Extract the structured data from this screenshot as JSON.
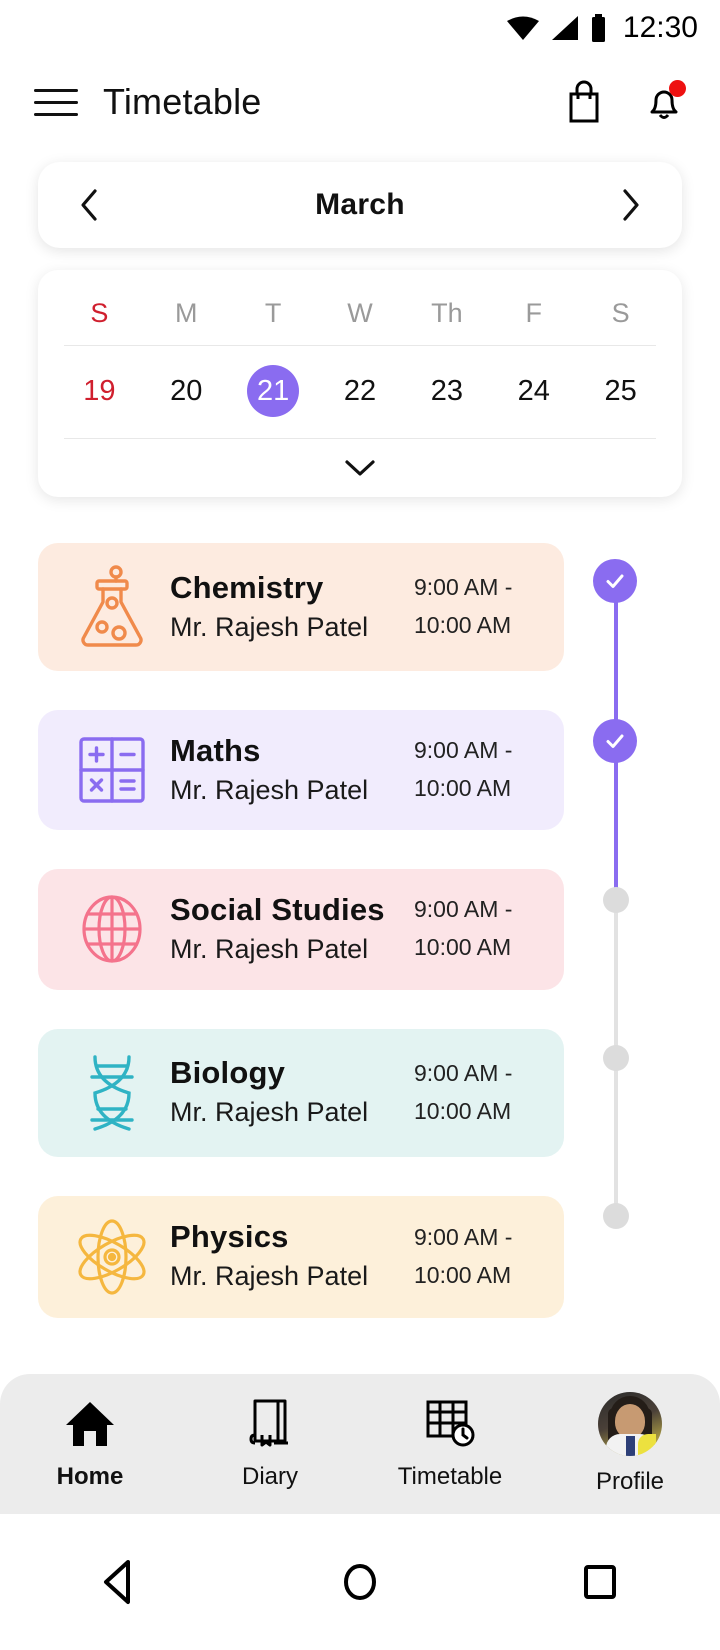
{
  "status_bar": {
    "time": "12:30",
    "wifi_icon": "wifi-icon",
    "signal_icon": "signal-icon",
    "battery_icon": "battery-icon"
  },
  "app_bar": {
    "title": "Timetable",
    "menu_icon": "hamburger-menu-icon",
    "bag_icon": "shopping-bag-icon",
    "bell_icon": "notification-bell-icon",
    "has_notification": true
  },
  "calendar": {
    "month": "March",
    "prev_label": "‹",
    "next_label": "›",
    "day_initials": [
      "S",
      "M",
      "T",
      "W",
      "Th",
      "F",
      "S"
    ],
    "dates": [
      "19",
      "20",
      "21",
      "22",
      "23",
      "24",
      "25"
    ],
    "selected_date": "21",
    "sunday_color": "#d01f2e",
    "selected_color": "#8a6cf0",
    "expand_icon": "chevron-down-icon"
  },
  "timetable": {
    "teacher_default": "Mr. Rajesh Patel",
    "entries": [
      {
        "subject": "Chemistry",
        "teacher": "Mr. Rajesh Patel",
        "time_start": "9:00 AM -",
        "time_end": "10:00 AM",
        "bg": "#fdebe0",
        "accent": "#f08a4b",
        "icon": "flask-icon",
        "status": "done"
      },
      {
        "subject": "Maths",
        "teacher": "Mr. Rajesh Patel",
        "time_start": "9:00 AM -",
        "time_end": "10:00 AM",
        "bg": "#f1ecfd",
        "accent": "#8a6cf0",
        "icon": "calculator-icon",
        "status": "done"
      },
      {
        "subject": "Social Studies",
        "teacher": "Mr. Rajesh Patel",
        "time_start": "9:00 AM -",
        "time_end": "10:00 AM",
        "bg": "#fce4e7",
        "accent": "#f4738c",
        "icon": "globe-icon",
        "status": "pending"
      },
      {
        "subject": "Biology",
        "teacher": "Mr. Rajesh Patel",
        "time_start": "9:00 AM -",
        "time_end": "10:00 AM",
        "bg": "#e3f3f2",
        "accent": "#2fb3c4",
        "icon": "dna-icon",
        "status": "pending"
      },
      {
        "subject": "Physics",
        "teacher": "Mr. Rajesh Patel",
        "time_start": "9:00 AM -",
        "time_end": "10:00 AM",
        "bg": "#fdf0da",
        "accent": "#f5b73f",
        "icon": "atom-icon",
        "status": "pending"
      }
    ]
  },
  "bottom_nav": {
    "items": [
      {
        "label": "Home",
        "icon": "home-icon",
        "active": true
      },
      {
        "label": "Diary",
        "icon": "book-icon",
        "active": false
      },
      {
        "label": "Timetable",
        "icon": "table-clock-icon",
        "active": false
      },
      {
        "label": "Profile",
        "icon": "avatar-icon",
        "active": false
      }
    ]
  },
  "android_nav": {
    "back_icon": "back-triangle-icon",
    "home_icon": "home-circle-icon",
    "recents_icon": "recents-square-icon"
  }
}
